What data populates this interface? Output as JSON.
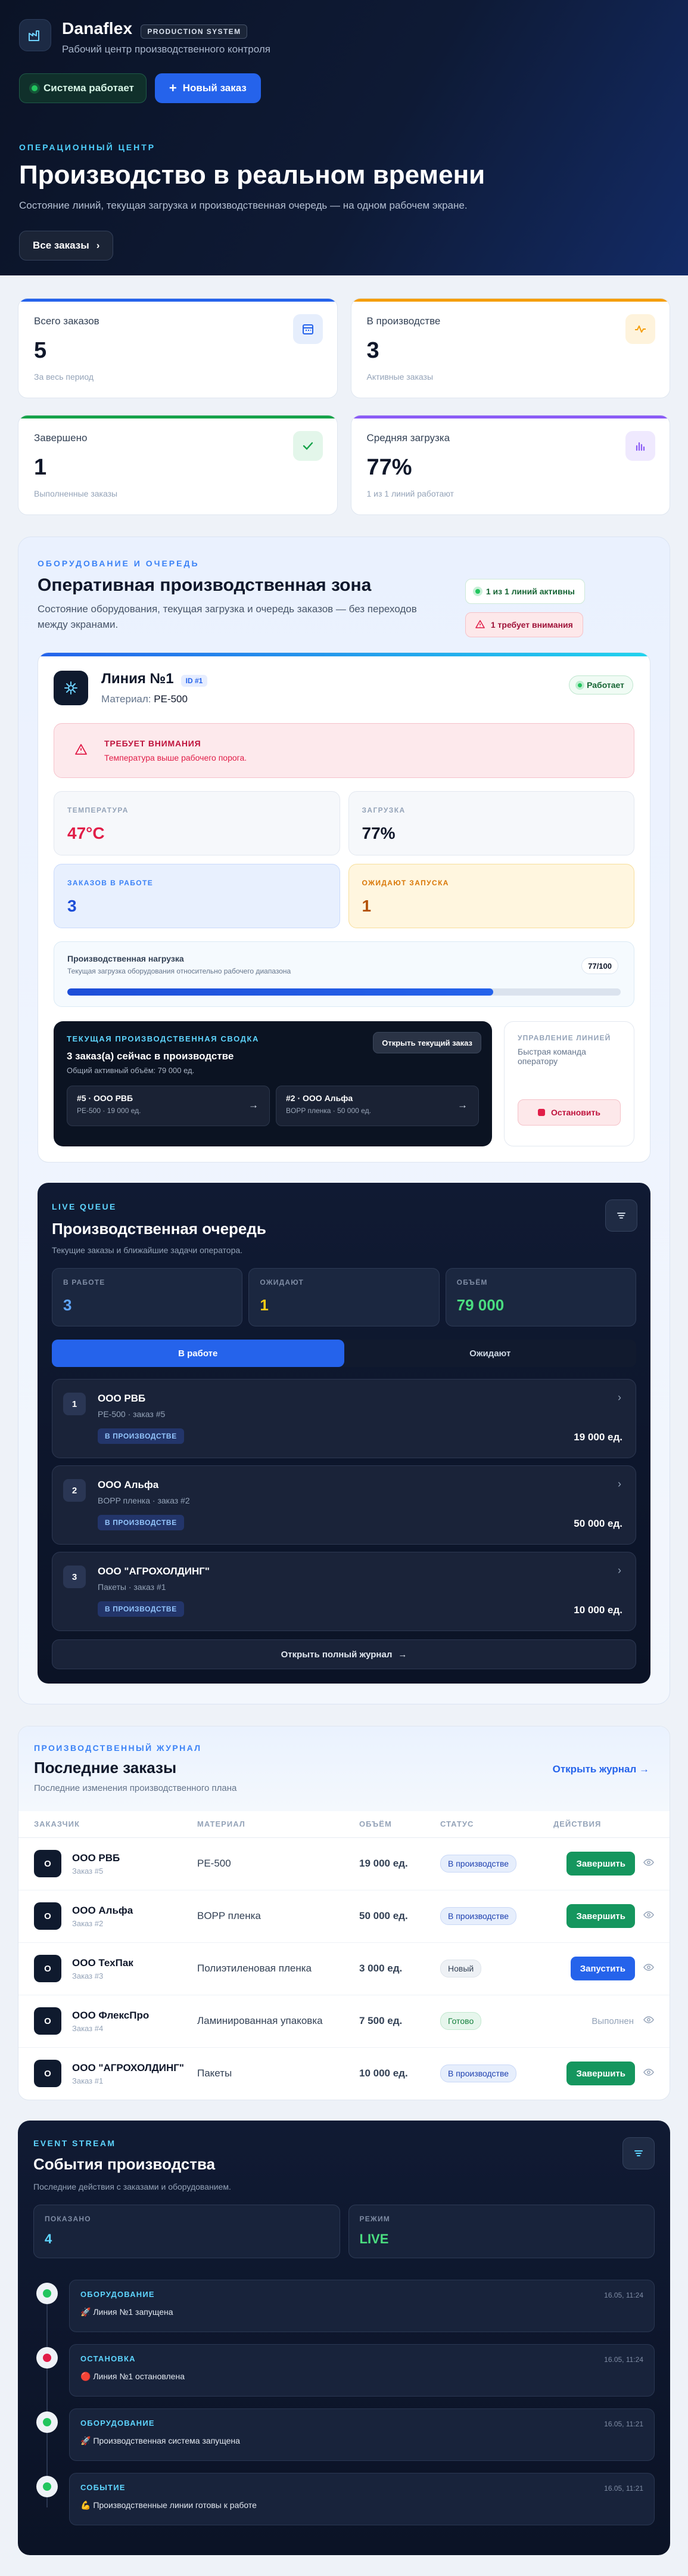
{
  "brand": {
    "name": "Danaflex",
    "tag": "PRODUCTION SYSTEM",
    "subtitle": "Рабочий центр производственного контроля"
  },
  "hero": {
    "system_status": "Система работает",
    "new_order": "Новый заказ",
    "eyebrow": "ОПЕРАЦИОННЫЙ ЦЕНТР",
    "title": "Производство в реальном времени",
    "description": "Состояние линий, текущая загрузка и производственная очередь — на одном рабочем экране.",
    "all_orders": "Все заказы"
  },
  "stats": [
    {
      "label": "Всего заказов",
      "value": "5",
      "sub": "За весь период",
      "color": "#2563eb",
      "icon": "calendar-icon"
    },
    {
      "label": "В производстве",
      "value": "3",
      "sub": "Активные заказы",
      "color": "#f59e0b",
      "icon": "activity-icon"
    },
    {
      "label": "Завершено",
      "value": "1",
      "sub": "Выполненные заказы",
      "color": "#16a34a",
      "icon": "check-icon"
    },
    {
      "label": "Средняя загрузка",
      "value": "77%",
      "sub": "1 из 1 линий работают",
      "color": "#8b5cf6",
      "icon": "bar-chart-icon"
    }
  ],
  "zone": {
    "eyebrow": "ОБОРУДОВАНИЕ И ОЧЕРЕДЬ",
    "title": "Оперативная производственная зона",
    "description": "Состояние оборудования, текущая загрузка и очередь заказов — без переходов между экранами.",
    "badge_active": "1 из 1 линий активны",
    "badge_attention": "1 требует внимания"
  },
  "line": {
    "name": "Линия №1",
    "id": "ID #1",
    "material_label": "Материал:",
    "material": "PE-500",
    "status": "Работает",
    "alert_title": "ТРЕБУЕТ ВНИМАНИЯ",
    "alert_text": "Температура выше рабочего порога.",
    "temp_label": "ТЕМПЕРАТУРА",
    "temp_value": "47°C",
    "load_label": "ЗАГРУЗКА",
    "load_value": "77%",
    "work_label": "ЗАКАЗОВ В РАБОТЕ",
    "work_value": "3",
    "wait_label": "ОЖИДАЮТ ЗАПУСКА",
    "wait_value": "1",
    "load_title": "Производственная нагрузка",
    "load_desc": "Текущая загрузка оборудования относительно рабочего диапазона",
    "load_badge": "77/100",
    "load_fraction": 0.77,
    "summary_eyebrow": "ТЕКУЩАЯ ПРОИЗВОДСТВЕННАЯ СВОДКА",
    "summary_title": "3 заказ(а) сейчас в производстве",
    "summary_desc": "Общий активный объём: 79 000 ед.",
    "summary_btn": "Открыть текущий заказ",
    "summary_orders": [
      {
        "name": "#5 · ООО РВБ",
        "meta": "PE-500 · 19 000 ед."
      },
      {
        "name": "#2 · ООО Альфа",
        "meta": "BOPP пленка · 50 000 ед."
      }
    ],
    "control_eyebrow": "УПРАВЛЕНИЕ ЛИНИЕЙ",
    "control_desc": "Быстрая команда оператору",
    "stop_btn": "Остановить"
  },
  "queue": {
    "eyebrow": "LIVE QUEUE",
    "title": "Производственная очередь",
    "description": "Текущие заказы и ближайшие задачи оператора.",
    "stats": [
      {
        "label": "В РАБОТЕ",
        "value": "3",
        "color": "#60a5fa"
      },
      {
        "label": "ОЖИДАЮТ",
        "value": "1",
        "color": "#facc15"
      },
      {
        "label": "ОБЪЁМ",
        "value": "79 000",
        "color": "#4ade80"
      }
    ],
    "tabs": [
      "В работе",
      "Ожидают"
    ],
    "items": [
      {
        "num": "1",
        "name": "ООО РВБ",
        "meta": "PE-500 · заказ #5",
        "badge": "В ПРОИЗВОДСТВЕ",
        "amount": "19 000 ед."
      },
      {
        "num": "2",
        "name": "ООО Альфа",
        "meta": "BOPP пленка · заказ #2",
        "badge": "В ПРОИЗВОДСТВЕ",
        "amount": "50 000 ед."
      },
      {
        "num": "3",
        "name": "ООО \"АГРОХОЛДИНГ\"",
        "meta": "Пакеты · заказ #1",
        "badge": "В ПРОИЗВОДСТВЕ",
        "amount": "10 000 ед."
      }
    ],
    "journal_btn": "Открыть полный журнал"
  },
  "journal": {
    "eyebrow": "ПРОИЗВОДСТВЕННЫЙ ЖУРНАЛ",
    "title": "Последние заказы",
    "description": "Последние изменения производственного плана",
    "link": "Открыть журнал →",
    "columns": [
      "ЗАКАЗЧИК",
      "МАТЕРИАЛ",
      "ОБЪЁМ",
      "СТАТУС",
      "ДЕЙСТВИЯ"
    ],
    "rows": [
      {
        "avatar": "О",
        "customer": "ООО РВБ",
        "order": "Заказ #5",
        "material": "PE-500",
        "volume": "19 000 ед.",
        "status": "В производстве",
        "status_kind": "prod",
        "action": "Завершить",
        "action_kind": "green"
      },
      {
        "avatar": "О",
        "customer": "ООО Альфа",
        "order": "Заказ #2",
        "material": "BOPP пленка",
        "volume": "50 000 ед.",
        "status": "В производстве",
        "status_kind": "prod",
        "action": "Завершить",
        "action_kind": "green"
      },
      {
        "avatar": "О",
        "customer": "ООО ТехПак",
        "order": "Заказ #3",
        "material": "Полиэтиленовая пленка",
        "volume": "3 000 ед.",
        "status": "Новый",
        "status_kind": "new",
        "action": "Запустить",
        "action_kind": "blue"
      },
      {
        "avatar": "О",
        "customer": "ООО ФлексПро",
        "order": "Заказ #4",
        "material": "Ламинированная упаковка",
        "volume": "7 500 ед.",
        "status": "Готово",
        "status_kind": "done",
        "action": "Выполнен",
        "action_kind": "txt"
      },
      {
        "avatar": "О",
        "customer": "ООО \"АГРОХОЛДИНГ\"",
        "order": "Заказ #1",
        "material": "Пакеты",
        "volume": "10 000 ед.",
        "status": "В производстве",
        "status_kind": "prod",
        "action": "Завершить",
        "action_kind": "green"
      }
    ]
  },
  "events": {
    "eyebrow": "EVENT STREAM",
    "title": "События производства",
    "description": "Последние действия с заказами и оборудованием.",
    "shown_label": "ПОКАЗАНО",
    "shown_value": "4",
    "mode_label": "РЕЖИМ",
    "mode_value": "LIVE",
    "items": [
      {
        "category": "ОБОРУДОВАНИЕ",
        "time": "16.05, 11:24",
        "text": "🚀 Линия №1 запущена",
        "dot": "#22c55e"
      },
      {
        "category": "ОСТАНОВКА",
        "time": "16.05, 11:24",
        "text": "🔴 Линия №1 остановлена",
        "dot": "#e11d48"
      },
      {
        "category": "ОБОРУДОВАНИЕ",
        "time": "16.05, 11:21",
        "text": "🚀 Производственная система запущена",
        "dot": "#22c55e"
      },
      {
        "category": "СОБЫТИЕ",
        "time": "16.05, 11:21",
        "text": "💪 Производственные линии готовы к работе",
        "dot": "#22c55e"
      }
    ]
  }
}
